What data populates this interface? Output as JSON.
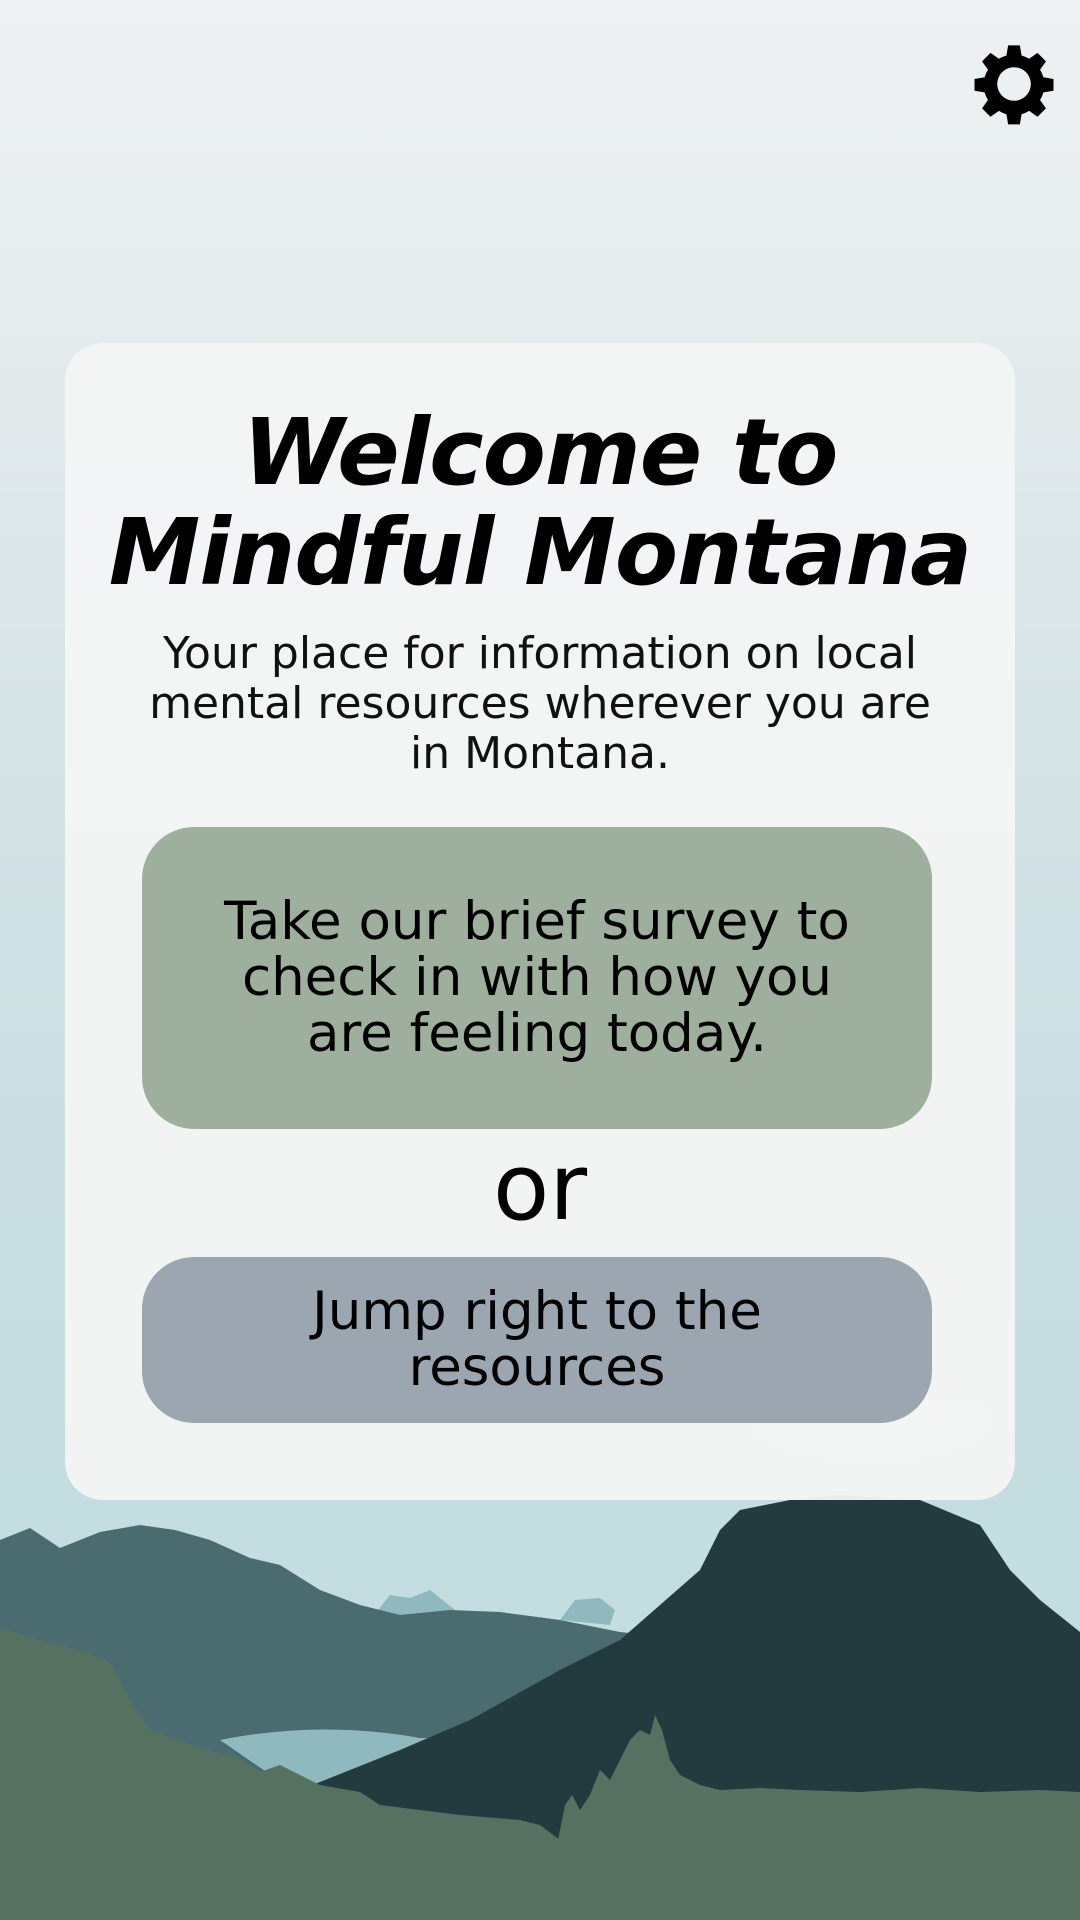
{
  "header": {
    "settings_icon": "gear-icon"
  },
  "welcome_card": {
    "title": "Welcome to Mindful Montana",
    "subtitle": "Your place for information on local mental resources wherever you are in Montana.",
    "survey_button_label": "Take our brief survey to check in with how you are feeling today.",
    "or_label": "or",
    "resources_button_label": "Jump right to the resources"
  },
  "colors": {
    "survey_button": "#9eb09d",
    "resources_button": "#9ca6b0",
    "card_background": "#f4f5f5",
    "far_mountains": "#4a6b6f",
    "near_mountain": "#233a3e",
    "forest": "#56715f",
    "lake": "#8fb9bf"
  }
}
